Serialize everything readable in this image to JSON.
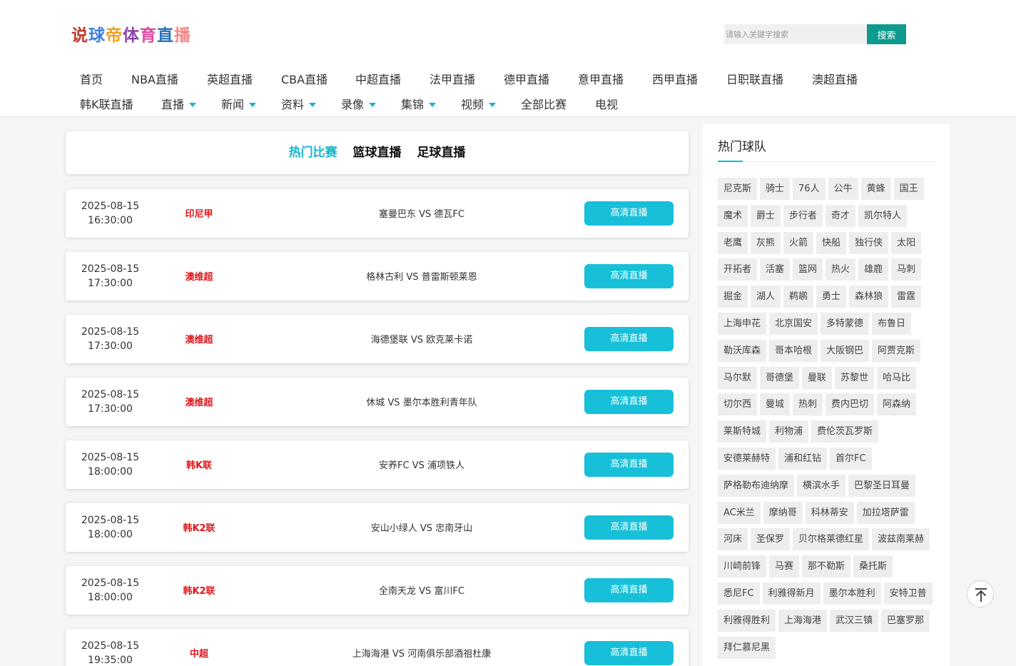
{
  "logo": {
    "chars": [
      "说",
      "球",
      "帝",
      "体",
      "育",
      "直",
      "播"
    ],
    "colors": [
      "#c0392b",
      "#3b7de0",
      "#f0a020",
      "#8e44ad",
      "#e04aa0",
      "#2a6fb5",
      "#f08a8a"
    ]
  },
  "search": {
    "placeholder": "请输入关键字搜索",
    "button_label": "搜索"
  },
  "nav": {
    "row1": [
      "首页",
      "NBA直播",
      "英超直播",
      "CBA直播",
      "中超直播",
      "法甲直播",
      "德甲直播",
      "意甲直播",
      "西甲直播",
      "日职联直播",
      "澳超直播"
    ],
    "row2": [
      {
        "label": "韩K联直播",
        "dropdown": false
      },
      {
        "label": "直播",
        "dropdown": true
      },
      {
        "label": "新闻",
        "dropdown": true
      },
      {
        "label": "资料",
        "dropdown": true
      },
      {
        "label": "录像",
        "dropdown": true
      },
      {
        "label": "集锦",
        "dropdown": true
      },
      {
        "label": "视频",
        "dropdown": true
      },
      {
        "label": "全部比赛",
        "dropdown": false
      },
      {
        "label": "电视",
        "dropdown": false
      }
    ]
  },
  "tabs": [
    {
      "label": "热门比赛",
      "active": true
    },
    {
      "label": "篮球直播",
      "active": false
    },
    {
      "label": "足球直播",
      "active": false
    }
  ],
  "matches": [
    {
      "date": "2025-08-15",
      "time": "16:30:00",
      "league": "印尼甲",
      "teams": "塞曼巴东 VS 德瓦FC",
      "button": "高清直播"
    },
    {
      "date": "2025-08-15",
      "time": "17:30:00",
      "league": "澳维超",
      "teams": "格林古利 VS 普雷斯顿莱恩",
      "button": "高清直播"
    },
    {
      "date": "2025-08-15",
      "time": "17:30:00",
      "league": "澳维超",
      "teams": "海德堡联 VS 欧克莱卡诺",
      "button": "高清直播"
    },
    {
      "date": "2025-08-15",
      "time": "17:30:00",
      "league": "澳维超",
      "teams": "休城 VS 墨尔本胜利青年队",
      "button": "高清直播"
    },
    {
      "date": "2025-08-15",
      "time": "18:00:00",
      "league": "韩K联",
      "teams": "安养FC VS 浦项铁人",
      "button": "高清直播"
    },
    {
      "date": "2025-08-15",
      "time": "18:00:00",
      "league": "韩K2联",
      "teams": "安山小绿人 VS 忠南牙山",
      "button": "高清直播"
    },
    {
      "date": "2025-08-15",
      "time": "18:00:00",
      "league": "韩K2联",
      "teams": "全南天龙 VS 富川FC",
      "button": "高清直播"
    },
    {
      "date": "2025-08-15",
      "time": "19:35:00",
      "league": "中超",
      "teams": "上海海港 VS 河南俱乐部酒祖杜康",
      "button": "高清直播"
    }
  ],
  "sidebar": {
    "title": "热门球队",
    "teams": [
      "尼克斯",
      "骑士",
      "76人",
      "公牛",
      "黄蜂",
      "国王",
      "魔术",
      "爵士",
      "步行者",
      "奇才",
      "凯尔特人",
      "老鹰",
      "灰熊",
      "火箭",
      "快船",
      "独行侠",
      "太阳",
      "开拓者",
      "活塞",
      "篮网",
      "热火",
      "雄鹿",
      "马刺",
      "掘金",
      "湖人",
      "鹈鹕",
      "勇士",
      "森林狼",
      "雷霆",
      "上海申花",
      "北京国安",
      "多特蒙德",
      "布鲁日",
      "勒沃库森",
      "哥本哈根",
      "大阪钢巴",
      "阿贾克斯",
      "马尔默",
      "哥德堡",
      "曼联",
      "苏黎世",
      "哈马比",
      "切尔西",
      "曼城",
      "热刺",
      "费内巴切",
      "阿森纳",
      "莱斯特城",
      "利物浦",
      "费伦茨瓦罗斯",
      "安德莱赫特",
      "浦和红钻",
      "首尔FC",
      "萨格勒布迪纳摩",
      "横滨水手",
      "巴黎圣日耳曼",
      "AC米兰",
      "摩纳哥",
      "科林蒂安",
      "加拉塔萨雷",
      "河床",
      "圣保罗",
      "贝尔格莱德红星",
      "波兹南莱赫",
      "川崎前锋",
      "马赛",
      "那不勒斯",
      "桑托斯",
      "悉尼FC",
      "利雅得新月",
      "墨尔本胜利",
      "安特卫普",
      "利雅得胜利",
      "上海海港",
      "武汉三镇",
      "巴塞罗那",
      "拜仁慕尼黑"
    ]
  },
  "colors": {
    "accent": "#17b6cc",
    "button": "#17c0d8",
    "league": "#e0161b",
    "search_button": "#0e9a8d"
  },
  "icons": {
    "back_to_top": "arrow-up-to-line-icon"
  }
}
